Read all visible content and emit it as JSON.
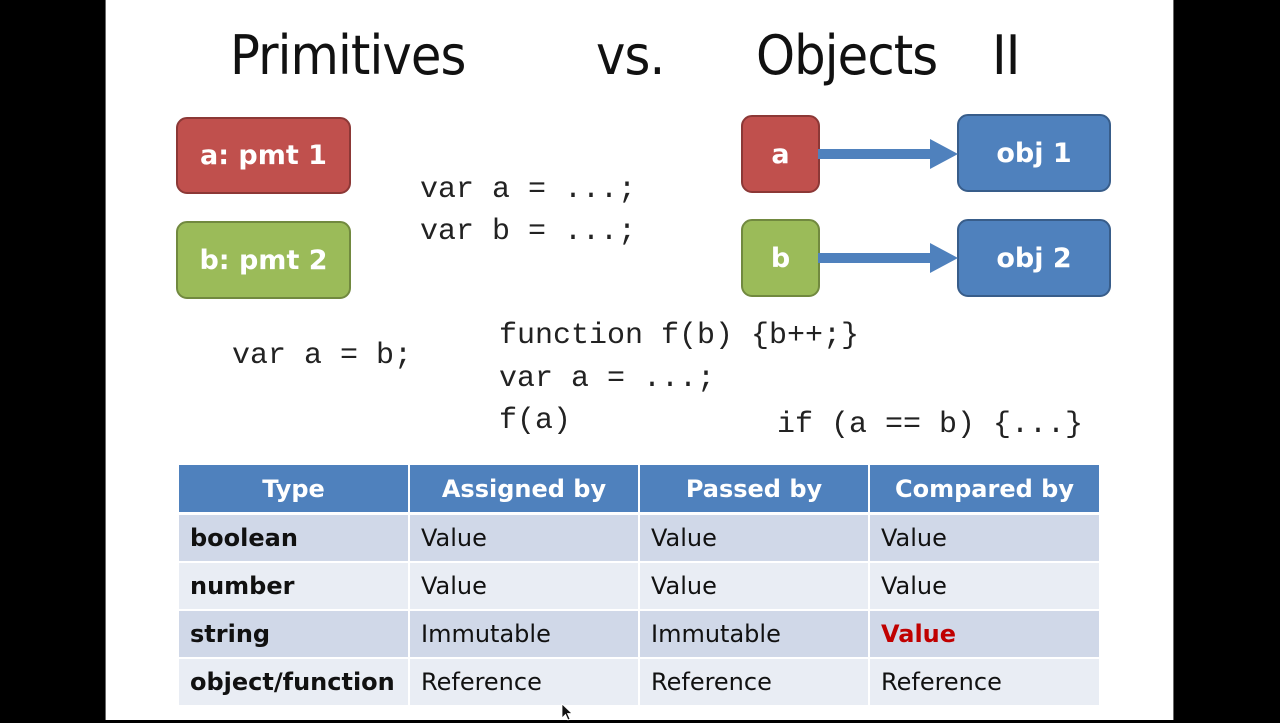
{
  "slide": {
    "title_parts": [
      "Primitives",
      "vs.",
      "Objects",
      "II"
    ],
    "primitive_boxes": [
      {
        "label": "a: pmt 1",
        "color": "#c0504d"
      },
      {
        "label": "b: pmt 2",
        "color": "#9bbb59"
      }
    ],
    "reference_boxes": [
      {
        "var_label": "a",
        "var_color": "#c0504d",
        "obj_label": "obj 1",
        "obj_color": "#4f81bd"
      },
      {
        "var_label": "b",
        "var_color": "#9bbb59",
        "obj_label": "obj 2",
        "obj_color": "#4f81bd"
      }
    ],
    "code": {
      "declarations": [
        "var a = ...;",
        "var b = ...;"
      ],
      "assignment": "var a = b;",
      "function_call": [
        "function f(b) {b++;}",
        "var a = ...;",
        "f(a)"
      ],
      "comparison": "if (a == b) {...}"
    },
    "table": {
      "headers": [
        "Type",
        "Assigned by",
        "Passed by",
        "Compared by"
      ],
      "rows": [
        [
          "boolean",
          "Value",
          "Value",
          "Value"
        ],
        [
          "number",
          "Value",
          "Value",
          "Value"
        ],
        [
          "string",
          "Immutable",
          "Immutable",
          "Value"
        ],
        [
          "object/function",
          "Reference",
          "Reference",
          "Reference"
        ]
      ],
      "highlight_color": "#c00000"
    }
  }
}
